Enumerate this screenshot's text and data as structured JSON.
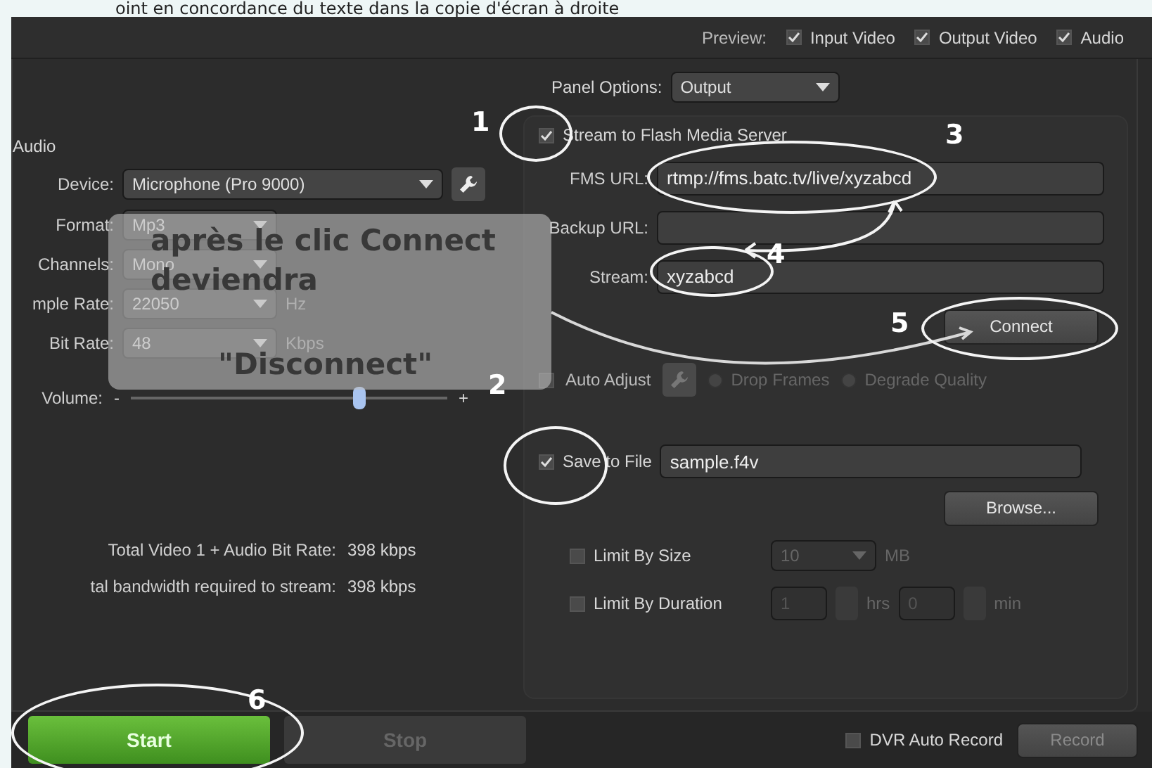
{
  "caption": "oint en concordance du texte dans la copie d'écran à droite",
  "preview": {
    "label": "Preview:",
    "options": [
      {
        "label": "Input Video",
        "checked": true
      },
      {
        "label": "Output Video",
        "checked": true
      },
      {
        "label": "Audio",
        "checked": true
      }
    ]
  },
  "audio": {
    "title": "Audio",
    "device": {
      "label": "Device:",
      "value": "Microphone (Pro 9000)"
    },
    "fields": [
      {
        "label": "Format:",
        "value": "Mp3"
      },
      {
        "label": "Channels:",
        "value": "Mono"
      },
      {
        "label": "mple Rate:",
        "value": "22050",
        "unit": "Hz"
      },
      {
        "label": "Bit Rate:",
        "value": "48",
        "unit": "Kbps"
      }
    ],
    "volume": {
      "label": "Volume:",
      "minus": "-",
      "plus": "+",
      "level": 0.72
    },
    "totals": [
      {
        "label": "Total Video 1 + Audio Bit Rate:",
        "value": "398 kbps"
      },
      {
        "label": "tal bandwidth required to stream:",
        "value": "398 kbps"
      }
    ]
  },
  "panel_options": {
    "label": "Panel Options:",
    "value": "Output"
  },
  "stream": {
    "label": "Stream to Flash Media Server",
    "checked": true,
    "fields": [
      {
        "label": "FMS URL:",
        "value": "rtmp://fms.batc.tv/live/xyzabcd"
      },
      {
        "label": "Backup URL:"
      },
      {
        "label": "Stream:",
        "value": "xyzabcd"
      }
    ],
    "connect": "Connect"
  },
  "auto_adjust": {
    "label": "Auto Adjust",
    "checked": false,
    "options": [
      {
        "label": "Drop Frames",
        "selected": false
      },
      {
        "label": "Degrade Quality",
        "selected": false
      }
    ]
  },
  "save_file": {
    "label": "Save to File",
    "checked": true,
    "value": "sample.f4v",
    "browse": "Browse..."
  },
  "limits": [
    {
      "kind": "select",
      "label": "Limit By Size",
      "checked": false,
      "value": "10",
      "unit": "MB"
    },
    {
      "kind": "duration",
      "label": "Limit By Duration",
      "checked": false,
      "hours": "1",
      "hours_unit": "hrs",
      "minutes": "0",
      "minutes_unit": "min"
    }
  ],
  "bottom": {
    "start": "Start",
    "stop": "Stop",
    "dvr": {
      "label": "DVR Auto Record",
      "checked": false
    },
    "record": "Record"
  },
  "annotations": {
    "numbers": [
      "1",
      "2",
      "3",
      "4",
      "5",
      "6"
    ],
    "note": [
      "après le clic Connect",
      "deviendra",
      "\"Disconnect\""
    ]
  }
}
